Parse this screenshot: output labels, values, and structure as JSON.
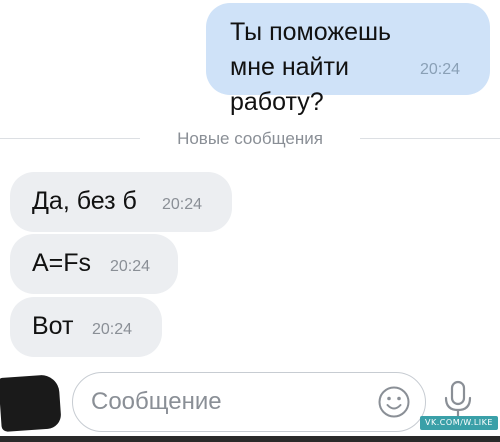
{
  "outgoing_message": {
    "text": "Ты поможешь мне найти работу?",
    "time": "20:24"
  },
  "divider": {
    "label": "Новые сообщения"
  },
  "incoming_messages": [
    {
      "text": "Да, без б",
      "time": "20:24"
    },
    {
      "text": "A=Fs",
      "time": "20:24"
    },
    {
      "text": "Вот",
      "time": "20:24"
    }
  ],
  "composer": {
    "placeholder": "Сообщение",
    "emoji_icon": "smiley-icon",
    "send_icon": "microphone-icon"
  },
  "watermark": {
    "text": "VK.COM/W.LIKE"
  },
  "colors": {
    "outgoing_bubble": "#cfe2f8",
    "incoming_bubble": "#eceef1",
    "timestamp": "#8a8f96",
    "divider_line": "#dcdfe3"
  }
}
